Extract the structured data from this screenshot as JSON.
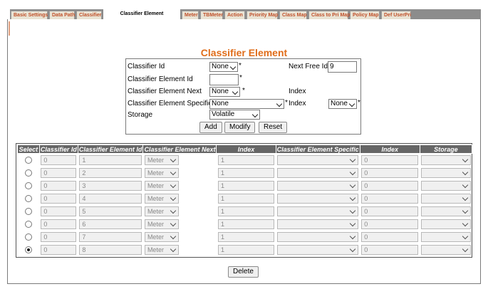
{
  "tabs": [
    {
      "label": "Basic Settings",
      "active": false
    },
    {
      "label": "Data Path",
      "active": false
    },
    {
      "label": "Classifier",
      "active": false
    },
    {
      "label": "Classifier Element",
      "active": true
    },
    {
      "label": "Meter",
      "active": false
    },
    {
      "label": "TBMeter",
      "active": false
    },
    {
      "label": "Action",
      "active": false
    },
    {
      "label": "Priority Map",
      "active": false
    },
    {
      "label": "Class Map",
      "active": false
    },
    {
      "label": "Class to Pri Map",
      "active": false
    },
    {
      "label": "Policy Map",
      "active": false
    },
    {
      "label": "Def UserPri",
      "active": false
    }
  ],
  "page_title": "Classifier Element",
  "form": {
    "classifier_id_label": "Classifier Id",
    "classifier_id_value": "None",
    "next_free_id_label": "Next Free Id",
    "next_free_id_value": "9",
    "classifier_element_id_label": "Classifier Element Id",
    "classifier_element_id_value": "",
    "classifier_element_next_label": "Classifier Element Next",
    "classifier_element_next_value": "None",
    "index_label": "Index",
    "classifier_element_specific_label": "Classifier Element Specific",
    "classifier_element_specific_value": "None",
    "index2_label": "Index",
    "index2_value": "None",
    "storage_label": "Storage",
    "storage_value": "Volatile",
    "required_mark": "*",
    "add_label": "Add",
    "modify_label": "Modify",
    "reset_label": "Reset"
  },
  "table": {
    "headers": [
      "Select",
      "Classifier Id",
      "Classifier Element Id",
      "Classifier Element Next",
      "Index",
      "Classifier Element Specific",
      "Index",
      "Storage"
    ],
    "rows": [
      {
        "selected": false,
        "classifier_id": "0",
        "element_id": "1",
        "next": "Meter",
        "index": "1",
        "specific": "",
        "index2": "0",
        "storage": ""
      },
      {
        "selected": false,
        "classifier_id": "0",
        "element_id": "2",
        "next": "Meter",
        "index": "1",
        "specific": "",
        "index2": "0",
        "storage": ""
      },
      {
        "selected": false,
        "classifier_id": "0",
        "element_id": "3",
        "next": "Meter",
        "index": "1",
        "specific": "",
        "index2": "0",
        "storage": ""
      },
      {
        "selected": false,
        "classifier_id": "0",
        "element_id": "4",
        "next": "Meter",
        "index": "1",
        "specific": "",
        "index2": "0",
        "storage": ""
      },
      {
        "selected": false,
        "classifier_id": "0",
        "element_id": "5",
        "next": "Meter",
        "index": "1",
        "specific": "",
        "index2": "0",
        "storage": ""
      },
      {
        "selected": false,
        "classifier_id": "0",
        "element_id": "6",
        "next": "Meter",
        "index": "1",
        "specific": "",
        "index2": "0",
        "storage": ""
      },
      {
        "selected": false,
        "classifier_id": "0",
        "element_id": "7",
        "next": "Meter",
        "index": "1",
        "specific": "",
        "index2": "0",
        "storage": ""
      },
      {
        "selected": true,
        "classifier_id": "0",
        "element_id": "8",
        "next": "Meter",
        "index": "1",
        "specific": "",
        "index2": "0",
        "storage": ""
      }
    ]
  },
  "delete_label": "Delete"
}
